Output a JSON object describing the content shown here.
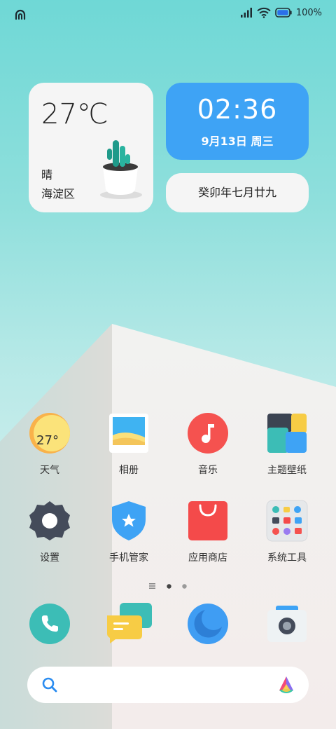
{
  "status_bar": {
    "battery_text": "100%",
    "left_icon": "hyper-logo-icon",
    "icons": [
      "signal-icon",
      "wifi-icon",
      "battery-icon"
    ]
  },
  "weather_widget": {
    "temperature": "27℃",
    "condition": "晴",
    "location": "海淀区"
  },
  "clock_widget": {
    "time": "02:36",
    "date": "9月13日  周三"
  },
  "lunar_widget": {
    "text": "癸卯年七月廿九"
  },
  "apps": [
    {
      "label": "天气",
      "icon": "weather-icon",
      "icon_text": "27°"
    },
    {
      "label": "相册",
      "icon": "gallery-icon"
    },
    {
      "label": "音乐",
      "icon": "music-icon"
    },
    {
      "label": "主题壁纸",
      "icon": "themes-icon"
    },
    {
      "label": "设置",
      "icon": "settings-gear-icon"
    },
    {
      "label": "手机管家",
      "icon": "security-shield-icon"
    },
    {
      "label": "应用商店",
      "icon": "app-store-bag-icon"
    },
    {
      "label": "系统工具",
      "icon": "tools-folder-icon"
    }
  ],
  "page_indicator": {
    "pages": 2,
    "active": 0
  },
  "dock": [
    {
      "icon": "phone-icon"
    },
    {
      "icon": "messages-icon"
    },
    {
      "icon": "browser-icon"
    },
    {
      "icon": "camera-icon"
    }
  ],
  "search": {
    "placeholder": ""
  },
  "colors": {
    "clock_bg": "#3ea3f5",
    "widget_bg": "#f5f5f5",
    "music_red": "#f5524f",
    "store_red": "#f44a4a",
    "phone_teal": "#3cbdb6",
    "browser_blue": "#3f9df3"
  }
}
